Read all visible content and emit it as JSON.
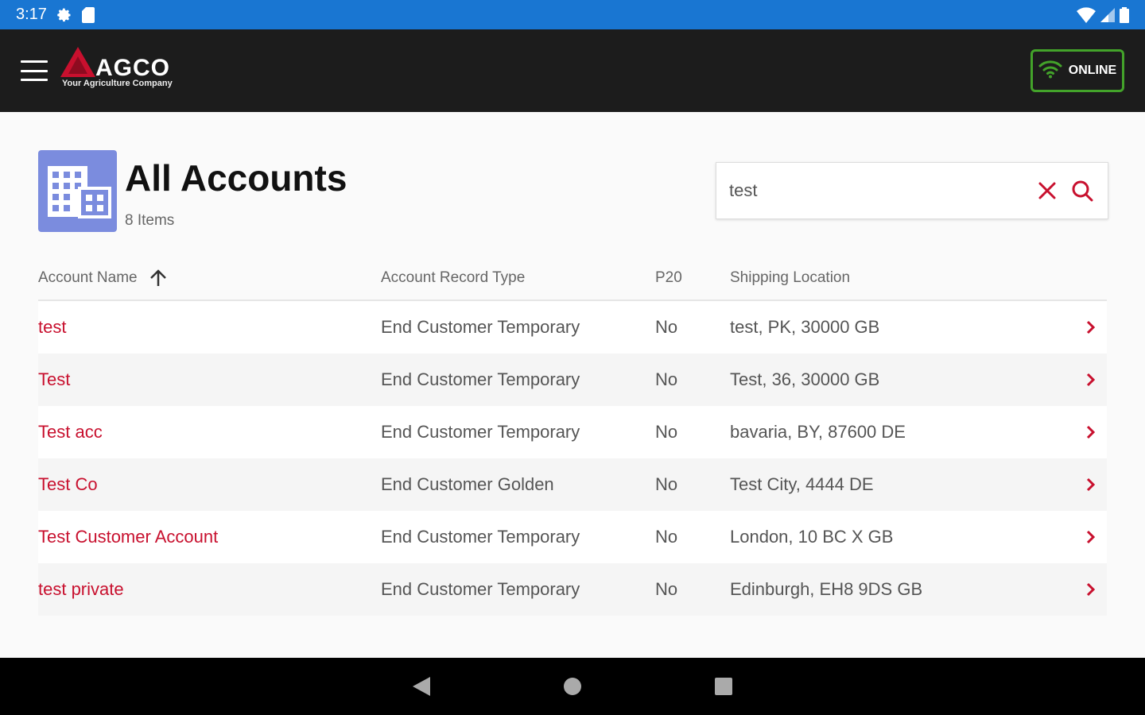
{
  "status_bar": {
    "time": "3:17"
  },
  "app_bar": {
    "logo_text": "AGCO",
    "logo_tagline": "Your Agriculture Company",
    "online_label": "ONLINE",
    "colors": {
      "background": "#1c1c1c",
      "online_border": "#43a32a",
      "brand_red": "#c8102e"
    }
  },
  "header": {
    "title": "All Accounts",
    "count": "8 Items"
  },
  "search": {
    "value": "test"
  },
  "table": {
    "columns": [
      "Account Name",
      "Account Record Type",
      "P20",
      "Shipping Location"
    ],
    "sort_icon": "arrow-up-icon",
    "rows": [
      {
        "name": "test",
        "type": "End Customer Temporary",
        "p20": "No",
        "shipping": "test, PK, 30000 GB"
      },
      {
        "name": "Test",
        "type": "End Customer Temporary",
        "p20": "No",
        "shipping": "Test, 36, 30000 GB"
      },
      {
        "name": "Test acc",
        "type": "End Customer Temporary",
        "p20": "No",
        "shipping": "bavaria, BY, 87600 DE"
      },
      {
        "name": "Test Co",
        "type": "End Customer Golden",
        "p20": "No",
        "shipping": "Test City, 4444 DE"
      },
      {
        "name": "Test Customer Account",
        "type": "End Customer Temporary",
        "p20": "No",
        "shipping": "London, 10 BC X GB"
      },
      {
        "name": "test private",
        "type": "End Customer Temporary",
        "p20": "No",
        "shipping": "Edinburgh, EH8 9DS GB"
      }
    ]
  },
  "nav_bar": {
    "icons": [
      "back-icon",
      "home-icon",
      "recents-icon"
    ]
  }
}
